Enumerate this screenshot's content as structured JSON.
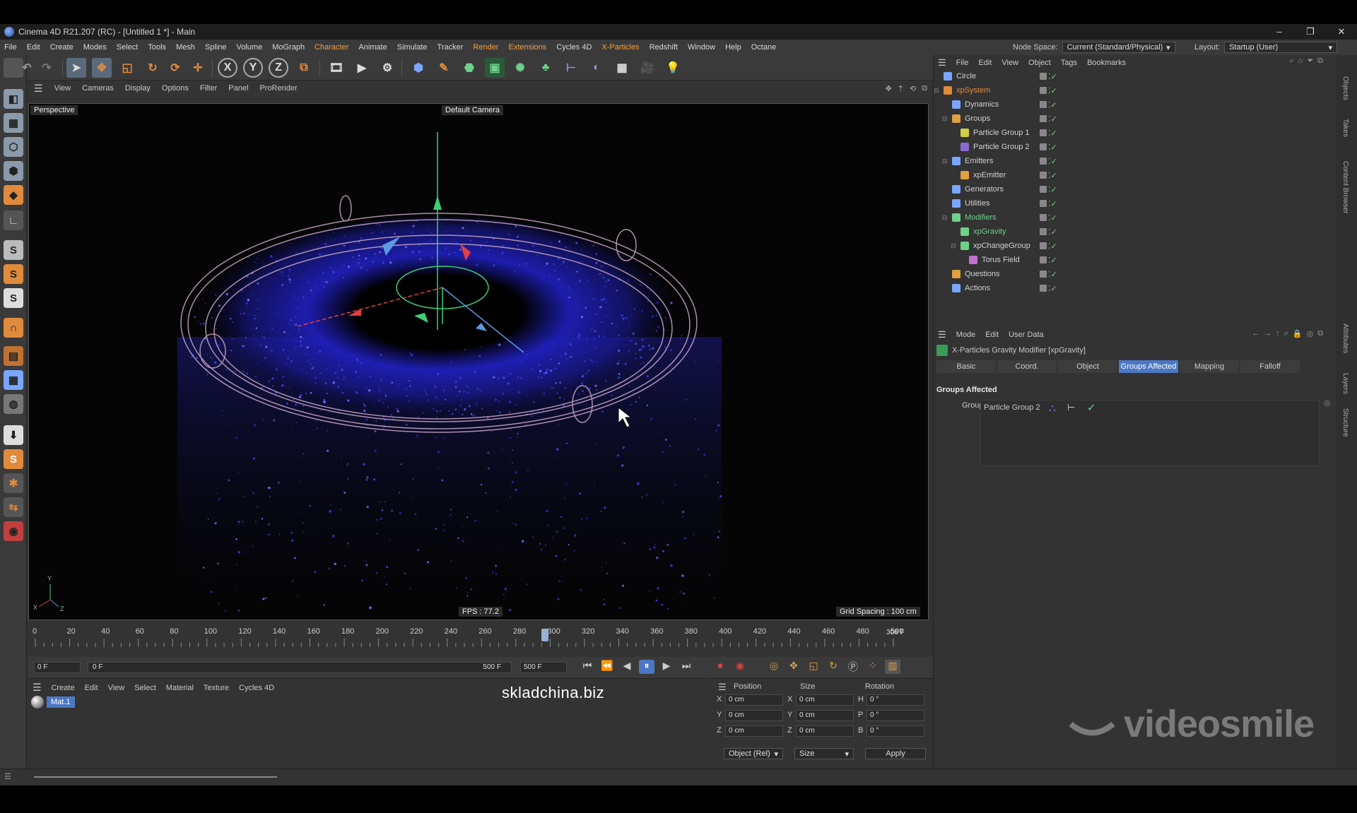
{
  "window": {
    "title": "Cinema 4D R21.207 (RC) - [Untitled 1 *] - Main",
    "controls": [
      "–",
      "❐",
      "✕"
    ]
  },
  "menu": [
    "File",
    "Edit",
    "Create",
    "Modes",
    "Select",
    "Tools",
    "Mesh",
    "Spline",
    "Volume",
    "MoGraph",
    "Character",
    "Animate",
    "Simulate",
    "Tracker",
    "Render",
    "Extensions",
    "Cycles 4D",
    "X-Particles",
    "Redshift",
    "Window",
    "Help",
    "Octane"
  ],
  "node_space": {
    "label": "Node Space:",
    "value": "Current (Standard/Physical)"
  },
  "layout": {
    "label": "Layout:",
    "value": "Startup (User)"
  },
  "viewport_menu": [
    "View",
    "Cameras",
    "Display",
    "Options",
    "Filter",
    "Panel",
    "ProRender"
  ],
  "viewport": {
    "name": "Perspective",
    "camera": "Default Camera",
    "fps": "FPS : 77.2",
    "grid": "Grid Spacing : 100 cm"
  },
  "timeline": {
    "ticks": [
      "0",
      "20",
      "40",
      "60",
      "80",
      "100",
      "120",
      "140",
      "160",
      "180",
      "200",
      "220",
      "240",
      "260",
      "280",
      "300",
      "320",
      "340",
      "360",
      "380",
      "400",
      "420",
      "440",
      "460",
      "480",
      "500"
    ],
    "current": "308 F"
  },
  "transport": {
    "start": "0 F",
    "range_start": "0 F",
    "range_end": "500 F",
    "end": "500 F"
  },
  "material_menu": [
    "Create",
    "Edit",
    "View",
    "Select",
    "Material",
    "Texture",
    "Cycles 4D"
  ],
  "material": {
    "name": "Mat.1"
  },
  "coords": {
    "headers": [
      "Position",
      "Size",
      "Rotation"
    ],
    "rows": [
      {
        "axis": "X",
        "pos": "0 cm",
        "saxis": "X",
        "size": "0 cm",
        "raxis": "H",
        "rot": "0 °"
      },
      {
        "axis": "Y",
        "pos": "0 cm",
        "saxis": "Y",
        "size": "0 cm",
        "raxis": "P",
        "rot": "0 °"
      },
      {
        "axis": "Z",
        "pos": "0 cm",
        "saxis": "Z",
        "size": "0 cm",
        "raxis": "B",
        "rot": "0 °"
      }
    ],
    "mode": "Object (Rel)",
    "size_mode": "Size",
    "apply": "Apply"
  },
  "object_menu": [
    "File",
    "Edit",
    "View",
    "Object",
    "Tags",
    "Bookmarks"
  ],
  "objects": [
    {
      "name": "Circle",
      "depth": 0,
      "color": "#7aa6ff",
      "hl": false
    },
    {
      "name": "xpSystem",
      "depth": 0,
      "color": "#e08a3c",
      "hl": true
    },
    {
      "name": "Dynamics",
      "depth": 1,
      "color": "#7aa6ff",
      "hl": false
    },
    {
      "name": "Groups",
      "depth": 1,
      "color": "#e0a040",
      "hl": false
    },
    {
      "name": "Particle Group 1",
      "depth": 2,
      "color": "#d0d040",
      "hl": false
    },
    {
      "name": "Particle Group 2",
      "depth": 2,
      "color": "#8a6ad0",
      "hl": false
    },
    {
      "name": "Emitters",
      "depth": 1,
      "color": "#7aa6ff",
      "hl": false
    },
    {
      "name": "xpEmitter",
      "depth": 2,
      "color": "#e0a040",
      "hl": false
    },
    {
      "name": "Generators",
      "depth": 1,
      "color": "#7aa6ff",
      "hl": false
    },
    {
      "name": "Utilities",
      "depth": 1,
      "color": "#7aa6ff",
      "hl": false
    },
    {
      "name": "Modifiers",
      "depth": 1,
      "color": "#6fd08a",
      "hl": true
    },
    {
      "name": "xpGravity",
      "depth": 2,
      "color": "#6fd08a",
      "hl": true
    },
    {
      "name": "xpChangeGroup",
      "depth": 2,
      "color": "#6fd08a",
      "hl": false
    },
    {
      "name": "Torus Field",
      "depth": 3,
      "color": "#c070d0",
      "hl": false
    },
    {
      "name": "Questions",
      "depth": 1,
      "color": "#e0a040",
      "hl": false
    },
    {
      "name": "Actions",
      "depth": 1,
      "color": "#7aa6ff",
      "hl": false
    }
  ],
  "attr_menu": [
    "Mode",
    "Edit",
    "User Data"
  ],
  "attr": {
    "title": "X-Particles Gravity Modifier [xpGravity]",
    "tabs": [
      "Basic",
      "Coord.",
      "Object",
      "Groups Affected",
      "Mapping",
      "Falloff"
    ],
    "active_tab": "Groups Affected",
    "section": "Groups Affected",
    "groups_label": "Groups",
    "group_item": "Particle Group 2"
  },
  "right_tabs": [
    "Objects",
    "Takes",
    "Content Browser",
    "Attributes",
    "Layers",
    "Structure"
  ],
  "watermarks": {
    "center": "skladchina.biz",
    "brand": "videosmile"
  }
}
